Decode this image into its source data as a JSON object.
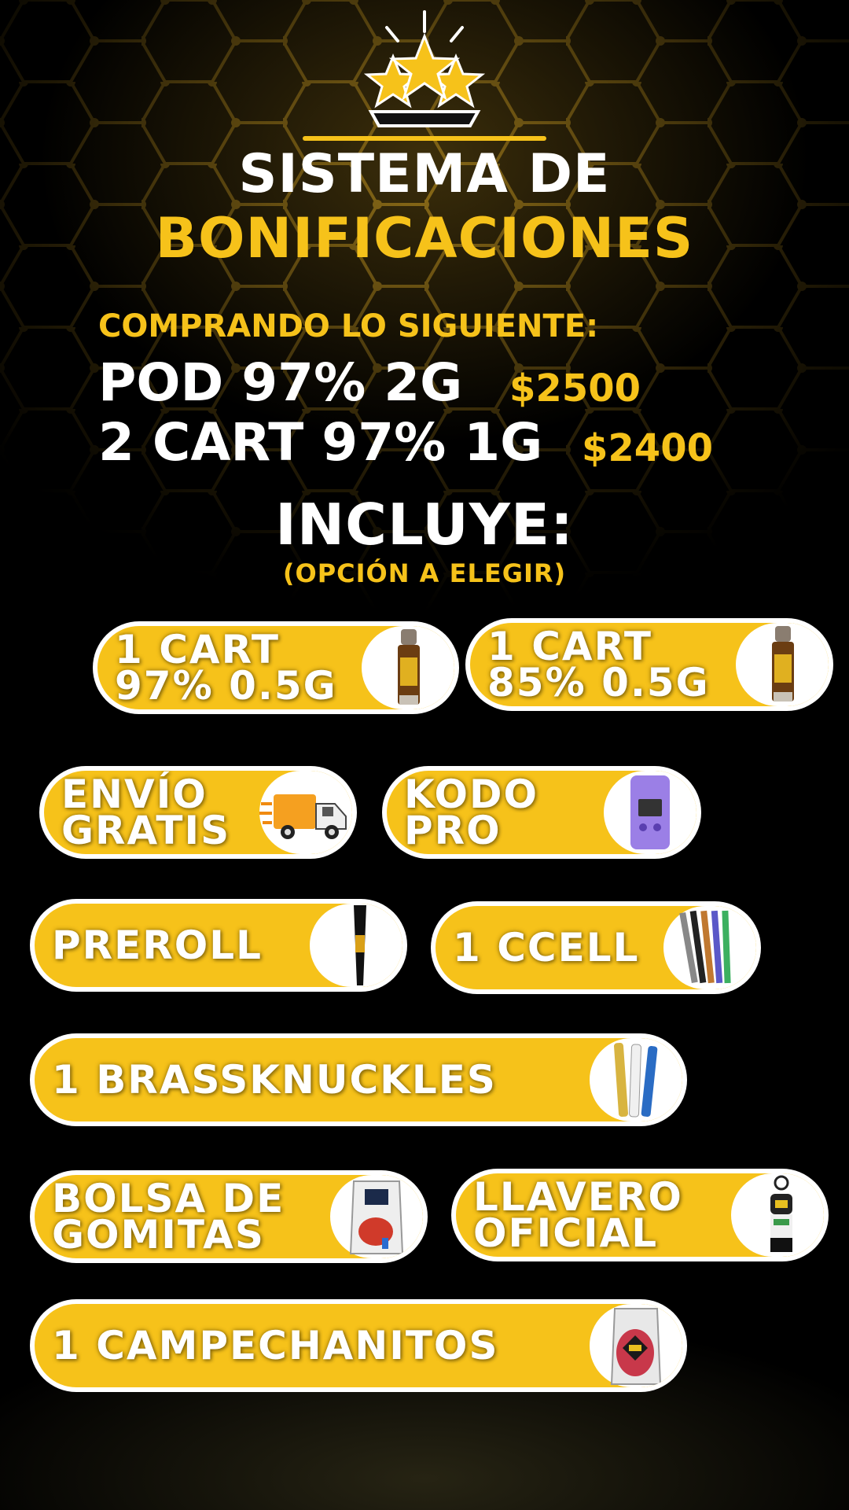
{
  "header": {
    "title_line1": "SISTEMA DE",
    "title_line2": "BONIFICACIONES"
  },
  "purchase": {
    "intro": "COMPRANDO LO SIGUIENTE:",
    "items": [
      {
        "name": "POD 97% 2G",
        "price": "$2500"
      },
      {
        "name": "2 CART 97% 1G",
        "price": "$2400"
      }
    ]
  },
  "includes": {
    "title": "INCLUYE:",
    "subtitle": "(OPCIÓN A ELEGIR)"
  },
  "options": [
    {
      "line1": "1 CART",
      "line2": "97% 0.5G",
      "icon": "cartridge-icon"
    },
    {
      "line1": "1 CART",
      "line2": "85% 0.5G",
      "icon": "cartridge-icon"
    },
    {
      "line1": "ENVÍO",
      "line2": "GRATIS",
      "icon": "delivery-truck-icon"
    },
    {
      "line1": "KODO",
      "line2": "PRO",
      "icon": "vape-device-icon"
    },
    {
      "line1": "PREROLL",
      "line2": "",
      "icon": "preroll-icon"
    },
    {
      "line1": "1 CCELL",
      "line2": "",
      "icon": "ccell-battery-icon"
    },
    {
      "line1": "1 BRASSKNUCKLES",
      "line2": "",
      "icon": "battery-pens-icon"
    },
    {
      "line1": "BOLSA DE",
      "line2": "GOMITAS",
      "icon": "gummy-bag-icon"
    },
    {
      "line1": "LLAVERO",
      "line2": "OFICIAL",
      "icon": "keychain-icon"
    },
    {
      "line1": "1 CAMPECHANITOS",
      "line2": "",
      "icon": "candy-bag-icon"
    }
  ],
  "colors": {
    "accent": "#f6c21a",
    "text": "#ffffff",
    "background": "#000000"
  }
}
